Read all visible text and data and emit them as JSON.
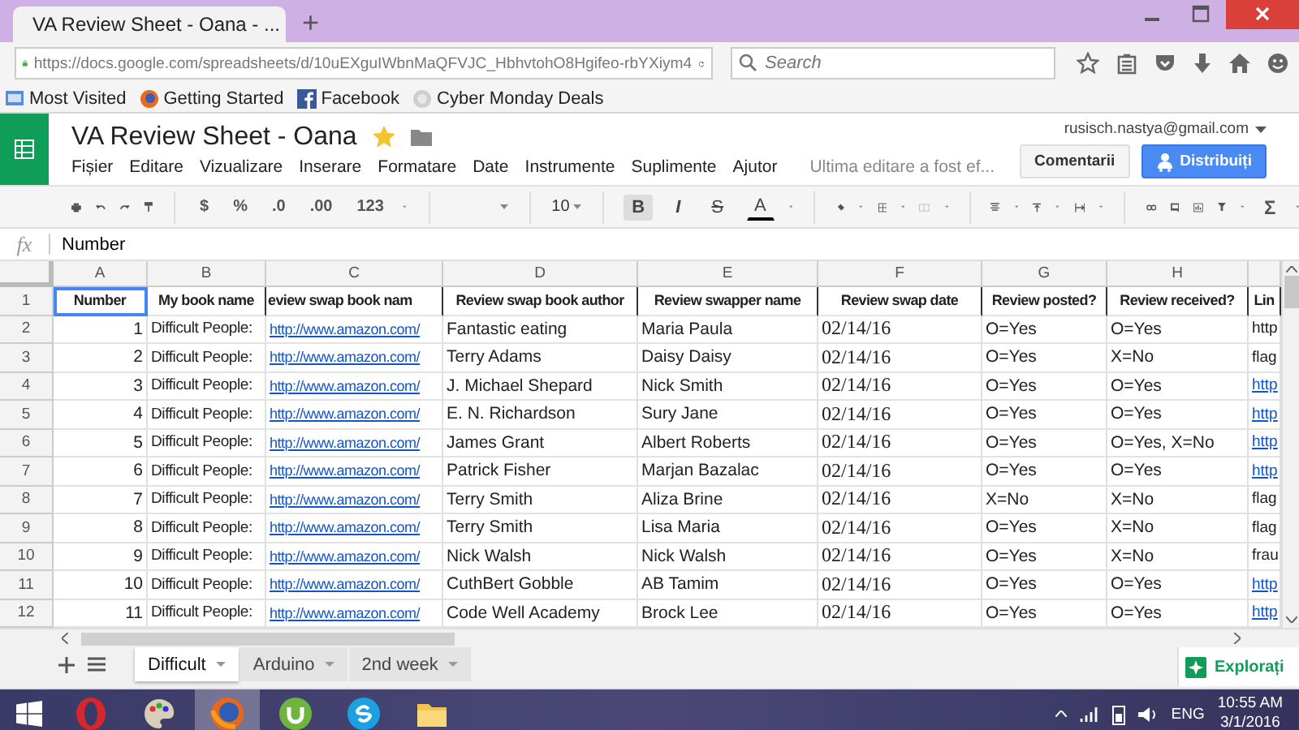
{
  "browser": {
    "tab_title": "VA Review Sheet - Oana - ...",
    "new_tab": "+",
    "url": "https://docs.google.com/spreadsheets/d/10uEXguIWbnMaQFVJC_HbhvtohO8Hgifeo-rbYXiym4",
    "search": {
      "placeholder": "Search"
    },
    "bookmarks": [
      "Most Visited",
      "Getting Started",
      "Facebook",
      "Cyber Monday Deals"
    ]
  },
  "doc": {
    "title": "VA Review Sheet - Oana",
    "starred": true,
    "account": "rusisch.nastya@gmail.com",
    "menu": [
      "Fișier",
      "Editare",
      "Vizualizare",
      "Inserare",
      "Formatare",
      "Date",
      "Instrumente",
      "Suplimente",
      "Ajutor"
    ],
    "last_edit": "Ultima editare a fost ef...",
    "comments_button": "Comentarii",
    "share_button": "Distribuiți"
  },
  "toolbar": {
    "number_formats": [
      "$",
      "%",
      ".0",
      ".00",
      "123"
    ],
    "font_size": "10",
    "text_formats": [
      {
        "label": "B",
        "active": true
      },
      {
        "label": "I",
        "active": false
      },
      {
        "label": "S",
        "active": false
      },
      {
        "label": "A",
        "active": false
      }
    ],
    "function": "Σ"
  },
  "formula_bar": {
    "label": "fx",
    "value": "Number"
  },
  "sheet": {
    "columns": [
      "A",
      "B",
      "C",
      "D",
      "E",
      "F",
      "G",
      "H"
    ],
    "header_row": {
      "row": "1",
      "cells": [
        "Number",
        "My book name",
        "eview swap book nam",
        "Review swap book author",
        "Review swapper name",
        "Review swap date",
        "Review posted?",
        "Review received?",
        "Lin"
      ]
    },
    "rows": [
      {
        "row": "2",
        "cells": [
          "1",
          "Difficult People:",
          {
            "text": "http://www.amazon.com/",
            "link": true
          },
          "Fantastic eating",
          "Maria Paula",
          "02/14/16",
          "O=Yes",
          "O=Yes",
          {
            "text": "http",
            "link": false
          }
        ]
      },
      {
        "row": "3",
        "cells": [
          "2",
          "Difficult People:",
          {
            "text": "http://www.amazon.com/",
            "link": true
          },
          "Terry Adams",
          "Daisy Daisy",
          "02/14/16",
          "O=Yes",
          "X=No",
          {
            "text": "flag",
            "link": false
          }
        ]
      },
      {
        "row": "4",
        "cells": [
          "3",
          "Difficult People:",
          {
            "text": "http://www.amazon.com/",
            "link": true
          },
          "J. Michael Shepard",
          "Nick Smith",
          "02/14/16",
          "O=Yes",
          "O=Yes",
          {
            "text": "http",
            "link": true
          }
        ]
      },
      {
        "row": "5",
        "cells": [
          "4",
          "Difficult People:",
          {
            "text": "http://www.amazon.com/",
            "link": true
          },
          "E. N. Richardson",
          "Sury Jane",
          "02/14/16",
          "O=Yes",
          "O=Yes",
          {
            "text": "http",
            "link": true
          }
        ]
      },
      {
        "row": "6",
        "cells": [
          "5",
          "Difficult People:",
          {
            "text": "http://www.amazon.com/",
            "link": true
          },
          "James Grant",
          "Albert Roberts",
          "02/14/16",
          "O=Yes",
          "O=Yes, X=No",
          {
            "text": "http",
            "link": true
          }
        ]
      },
      {
        "row": "7",
        "cells": [
          "6",
          "Difficult People:",
          {
            "text": "http://www.amazon.com/",
            "link": true
          },
          "Patrick Fisher",
          "Marjan Bazalac",
          "02/14/16",
          "O=Yes",
          "O=Yes",
          {
            "text": "http",
            "link": true
          }
        ]
      },
      {
        "row": "8",
        "cells": [
          "7",
          "Difficult People:",
          {
            "text": "http://www.amazon.com/",
            "link": true
          },
          "Terry Smith",
          "Aliza Brine",
          "02/14/16",
          "X=No",
          "X=No",
          {
            "text": "flag",
            "link": false
          }
        ]
      },
      {
        "row": "9",
        "cells": [
          "8",
          "Difficult People:",
          {
            "text": "http://www.amazon.com/",
            "link": true
          },
          "Terry Smith",
          "Lisa Maria",
          "02/14/16",
          "O=Yes",
          "X=No",
          {
            "text": "flag",
            "link": false
          }
        ]
      },
      {
        "row": "10",
        "cells": [
          "9",
          "Difficult People:",
          {
            "text": "http://www.amazon.com/",
            "link": true
          },
          "Nick Walsh",
          "Nick Walsh",
          "02/14/16",
          "O=Yes",
          "X=No",
          {
            "text": "frau",
            "link": false
          }
        ]
      },
      {
        "row": "11",
        "cells": [
          "10",
          "Difficult People:",
          {
            "text": "http://www.amazon.com/",
            "link": true
          },
          "CuthBert Gobble",
          "AB Tamim",
          "02/14/16",
          "O=Yes",
          "O=Yes",
          {
            "text": "http",
            "link": true
          }
        ]
      },
      {
        "row": "12",
        "cells": [
          "11",
          "Difficult People:",
          {
            "text": "http://www.amazon.com/",
            "link": true
          },
          "Code Well Academy",
          "Brock Lee",
          "02/14/16",
          "O=Yes",
          "O=Yes",
          {
            "text": "http",
            "link": true
          }
        ]
      }
    ]
  },
  "sheet_tabs": [
    {
      "label": "Difficult",
      "selected": true
    },
    {
      "label": "Arduino",
      "selected": false
    },
    {
      "label": "2nd week",
      "selected": false
    }
  ],
  "explore_button": "Explorați",
  "taskbar": {
    "apps": [
      {
        "selected": false
      },
      {
        "selected": false
      },
      {
        "selected": true
      },
      {
        "selected": false
      },
      {
        "selected": false
      },
      {
        "selected": false
      }
    ],
    "language": "ENG",
    "time": "10:55 AM",
    "date": "3/1/2016"
  }
}
